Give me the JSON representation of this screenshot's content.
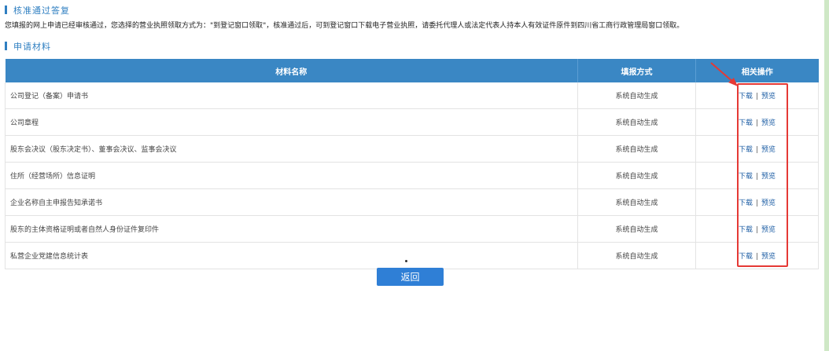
{
  "sections": {
    "approval_title": "核准通过答复",
    "approval_text": "您填报的网上申请已经审核通过，您选择的营业执照领取方式为：\"到登记窗口领取\"，核准通过后，可到登记窗口下载电子营业执照，请委托代理人或法定代表人持本人有效证件原件到四川省工商行政管理局窗口领取。",
    "materials_title": "申请材料"
  },
  "table": {
    "headers": {
      "name": "材料名称",
      "method": "填报方式",
      "ops": "相关操作"
    },
    "rows": [
      {
        "name": "公司登记（备案）申请书",
        "method": "系统自动生成",
        "download": "下载",
        "separator": "|",
        "preview": "预览"
      },
      {
        "name": "公司章程",
        "method": "系统自动生成",
        "download": "下载",
        "separator": "|",
        "preview": "预览"
      },
      {
        "name": "股东会决议（股东决定书）、董事会决议、监事会决议",
        "method": "系统自动生成",
        "download": "下载",
        "separator": "|",
        "preview": "预览"
      },
      {
        "name": "住所（经营场所）信息证明",
        "method": "系统自动生成",
        "download": "下载",
        "separator": "|",
        "preview": "预览"
      },
      {
        "name": "企业名称自主申报告知承诺书",
        "method": "系统自动生成",
        "download": "下载",
        "separator": "|",
        "preview": "预览"
      },
      {
        "name": "股东的主体资格证明或者自然人身份证件复印件",
        "method": "系统自动生成",
        "download": "下载",
        "separator": "|",
        "preview": "预览"
      },
      {
        "name": "私营企业党建信息统计表",
        "method": "系统自动生成",
        "download": "下载",
        "separator": "|",
        "preview": "预览"
      }
    ]
  },
  "actions": {
    "back_label": "返回"
  },
  "colors": {
    "accent": "#2f7fc1",
    "header_bg": "#3a87c4",
    "button_bg": "#2f7fd6",
    "annotation": "#e53935"
  }
}
